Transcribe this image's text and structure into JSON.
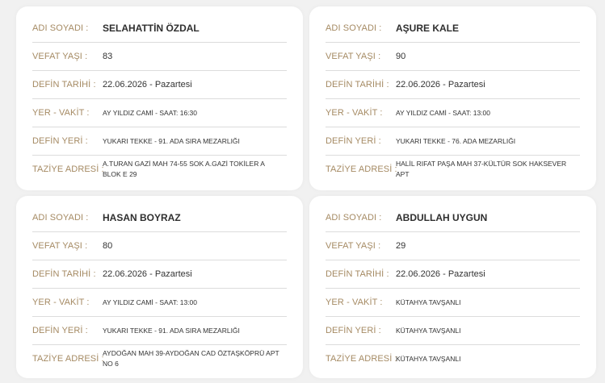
{
  "labels": {
    "name": "ADI SOYADI :",
    "age": "VEFAT YAŞI :",
    "date": "DEFİN TARİHİ :",
    "place_time": "YER - VAKİT :",
    "burial": "DEFİN YERİ :",
    "condolence": "TAZİYE ADRESİ :"
  },
  "cards": [
    {
      "name": "SELAHATTİN ÖZDAL",
      "age": "83",
      "date": "22.06.2026 - Pazartesi",
      "place_time": "AY YILDIZ CAMİ - SAAT: 16:30",
      "burial": "YUKARI TEKKE - 91. ADA SIRA MEZARLIĞI",
      "condolence": "A.TURAN GAZİ MAH 74-55 SOK A.GAZİ TOKİLER A BLOK E 29"
    },
    {
      "name": "AŞURE KALE",
      "age": "90",
      "date": "22.06.2026 - Pazartesi",
      "place_time": "AY YILDIZ CAMİ - SAAT: 13:00",
      "burial": "YUKARI TEKKE - 76. ADA MEZARLIĞI",
      "condolence": "HALİL RIFAT PAŞA MAH 37-KÜLTÜR SOK HAKSEVER APT"
    },
    {
      "name": "HASAN BOYRAZ",
      "age": "80",
      "date": "22.06.2026 - Pazartesi",
      "place_time": "AY YILDIZ CAMİ - SAAT: 13:00",
      "burial": "YUKARI TEKKE - 91. ADA SIRA MEZARLIĞI",
      "condolence": "AYDOĞAN MAH 39-AYDOĞAN CAD ÖZTAŞKÖPRÜ APT NO 6"
    },
    {
      "name": "ABDULLAH UYGUN",
      "age": "29",
      "date": "22.06.2026 - Pazartesi",
      "place_time": "KÜTAHYA TAVŞANLI",
      "burial": "KÜTAHYA TAVŞANLI",
      "condolence": "KÜTAHYA TAVŞANLI"
    }
  ]
}
